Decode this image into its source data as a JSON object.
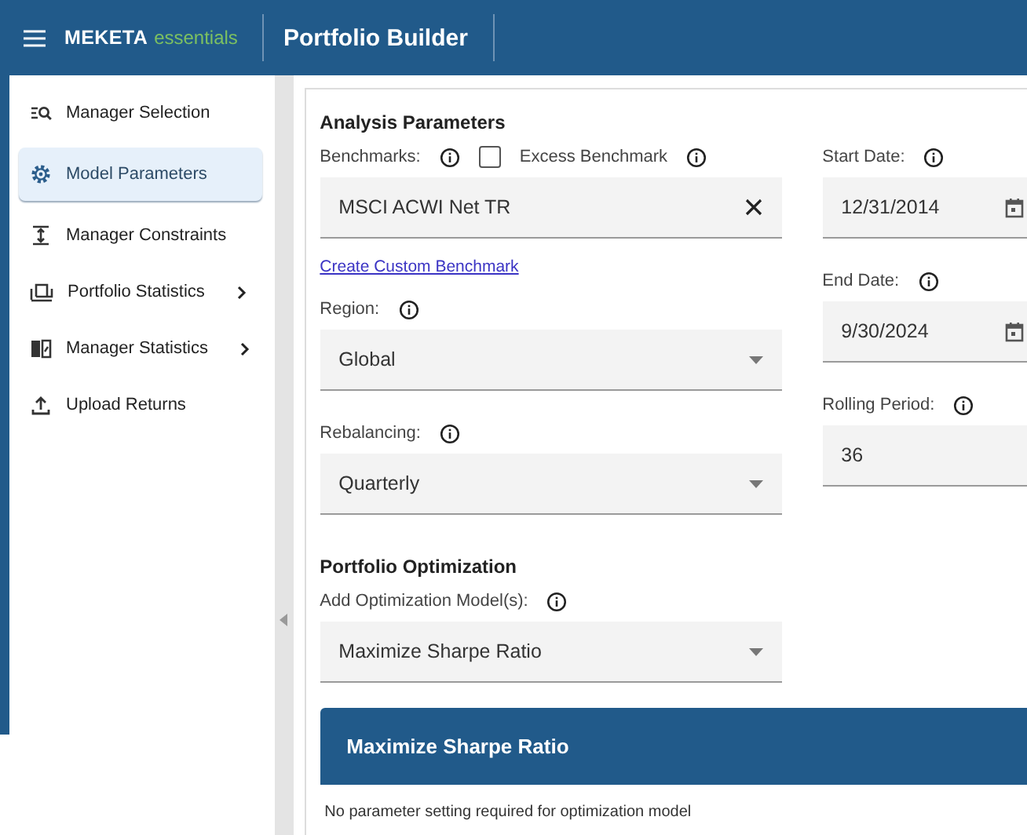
{
  "header": {
    "brand": "MEKETA",
    "brand_sub": "essentials",
    "title": "Portfolio Builder"
  },
  "sidebar": {
    "items": [
      {
        "label": "Manager Selection",
        "selected": false,
        "submenu": false
      },
      {
        "label": "Model Parameters",
        "selected": true,
        "submenu": false
      },
      {
        "label": "Manager Constraints",
        "selected": false,
        "submenu": false
      },
      {
        "label": "Portfolio Statistics",
        "selected": false,
        "submenu": true
      },
      {
        "label": "Manager Statistics",
        "selected": false,
        "submenu": true
      },
      {
        "label": "Upload Returns",
        "selected": false,
        "submenu": false
      }
    ]
  },
  "analysis_parameters": {
    "title": "Analysis Parameters",
    "benchmarks": {
      "label": "Benchmarks:",
      "excess": {
        "label": "Excess Benchmark",
        "checked": false
      },
      "field": {
        "kind": "clear",
        "value": "MSCI ACWI Net TR"
      }
    },
    "custom_link": "Create Custom Benchmark",
    "fields": [
      {
        "label": "Region:",
        "kind": "select",
        "value": "Global"
      },
      {
        "label": "Rebalancing:",
        "kind": "select",
        "value": "Quarterly"
      }
    ]
  },
  "dates": [
    {
      "label": "Start Date:",
      "kind": "date",
      "value": "12/31/2014"
    },
    {
      "label": "End Date:",
      "kind": "date",
      "value": "9/30/2024"
    },
    {
      "label": "Rolling Period:",
      "kind": "plain",
      "value": "36"
    }
  ],
  "portfolio_optimization": {
    "title": "Portfolio Optimization",
    "field": {
      "label": "Add Optimization Model(s):",
      "kind": "select",
      "value": "Maximize Sharpe Ratio"
    }
  },
  "model_card": {
    "title": "Maximize Sharpe Ratio",
    "text": "No parameter setting required for optimization model"
  }
}
